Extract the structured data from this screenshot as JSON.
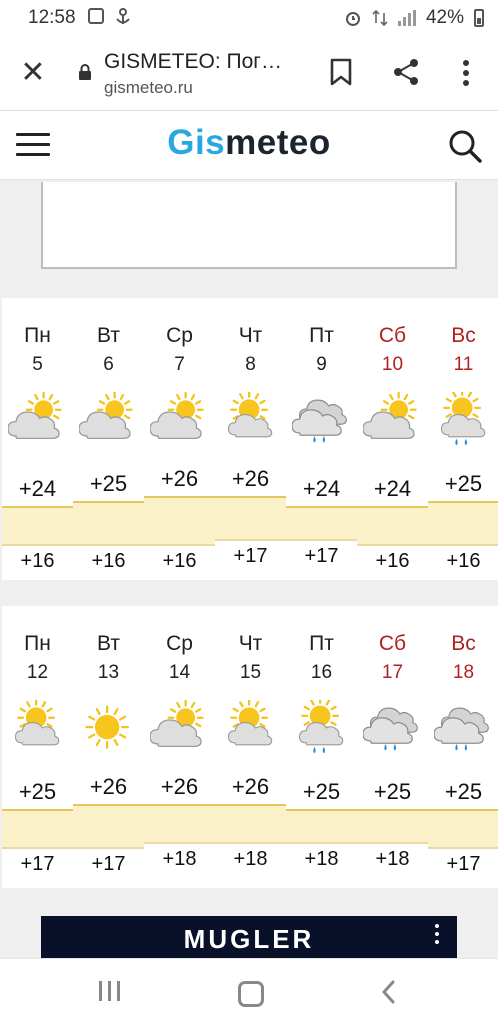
{
  "status_bar": {
    "time": "12:58",
    "battery": "42%",
    "left_icons": [
      "gallery-icon",
      "anchor-icon"
    ],
    "right_icons": [
      "alarm-icon",
      "data-icon",
      "signal-icon",
      "battery-icon"
    ]
  },
  "browser": {
    "title": "GISMETEO: Пог…",
    "url": "gismeteo.ru",
    "icons": [
      "close-icon",
      "lock-icon",
      "bookmark-icon",
      "share-icon",
      "more-vert-icon"
    ]
  },
  "site": {
    "logo_part1": "Gis",
    "logo_part2": "meteo",
    "icons": [
      "menu-icon",
      "search-icon"
    ]
  },
  "weeks": [
    {
      "days": [
        {
          "name": "Пн",
          "date": "5",
          "weekend": false,
          "icon": "partly-cloudy-icon",
          "max": "+24",
          "min": "+16"
        },
        {
          "name": "Вт",
          "date": "6",
          "weekend": false,
          "icon": "partly-cloudy-icon",
          "max": "+25",
          "min": "+16"
        },
        {
          "name": "Ср",
          "date": "7",
          "weekend": false,
          "icon": "partly-cloudy-icon",
          "max": "+26",
          "min": "+16"
        },
        {
          "name": "Чт",
          "date": "8",
          "weekend": false,
          "icon": "mostly-sunny-icon",
          "max": "+26",
          "min": "+17"
        },
        {
          "name": "Пт",
          "date": "9",
          "weekend": false,
          "icon": "cloudy-rain-icon",
          "max": "+24",
          "min": "+17"
        },
        {
          "name": "Сб",
          "date": "10",
          "weekend": true,
          "icon": "partly-cloudy-icon",
          "max": "+24",
          "min": "+16"
        },
        {
          "name": "Вс",
          "date": "11",
          "weekend": true,
          "icon": "sun-cloud-rain-icon",
          "max": "+25",
          "min": "+16"
        }
      ]
    },
    {
      "days": [
        {
          "name": "Пн",
          "date": "12",
          "weekend": false,
          "icon": "mostly-sunny-icon",
          "max": "+25",
          "min": "+17"
        },
        {
          "name": "Вт",
          "date": "13",
          "weekend": false,
          "icon": "sunny-icon",
          "max": "+26",
          "min": "+17"
        },
        {
          "name": "Ср",
          "date": "14",
          "weekend": false,
          "icon": "partly-cloudy-icon",
          "max": "+26",
          "min": "+18"
        },
        {
          "name": "Чт",
          "date": "15",
          "weekend": false,
          "icon": "mostly-sunny-icon",
          "max": "+26",
          "min": "+18"
        },
        {
          "name": "Пт",
          "date": "16",
          "weekend": false,
          "icon": "sun-cloud-rain-icon",
          "max": "+25",
          "min": "+18"
        },
        {
          "name": "Сб",
          "date": "17",
          "weekend": true,
          "icon": "cloudy-rain-icon",
          "max": "+25",
          "min": "+18"
        },
        {
          "name": "Вс",
          "date": "18",
          "weekend": true,
          "icon": "cloudy-rain-icon",
          "max": "+25",
          "min": "+17"
        }
      ]
    }
  ],
  "bottom_ad": {
    "brand": "MUGLER"
  },
  "navbar": {
    "icons": [
      "recent-apps-icon",
      "home-icon",
      "back-icon"
    ]
  },
  "colors": {
    "logo_blue": "#27a8e0",
    "logo_dark": "#1c2430",
    "weekend_red": "#b22121",
    "temp_band": "#fbf1c9",
    "temp_band_border": "#e4c65a"
  }
}
